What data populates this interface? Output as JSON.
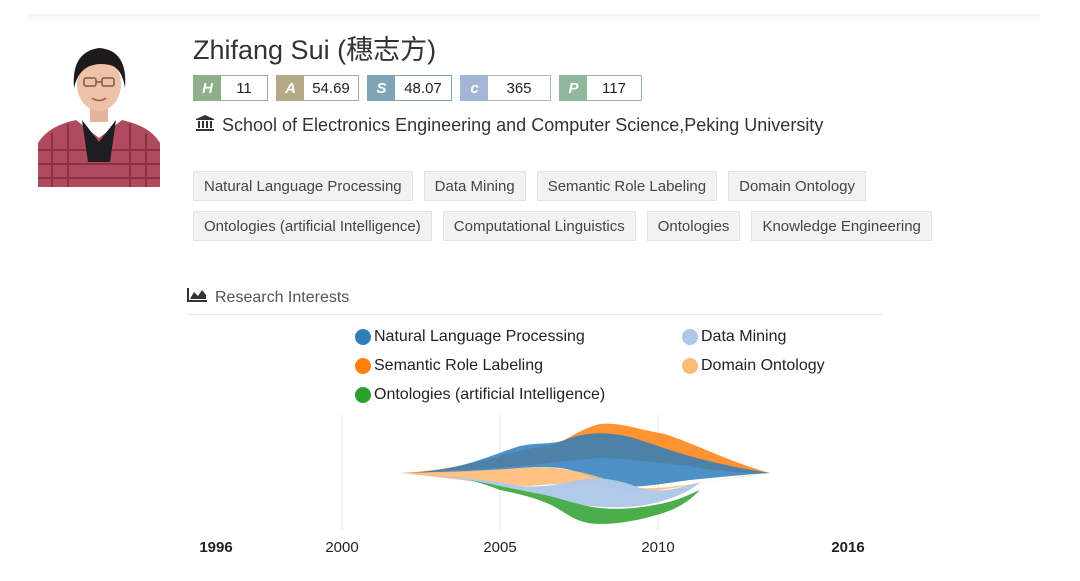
{
  "profile": {
    "name": "Zhifang Sui (穗志方)",
    "affiliation": "School of Electronics Engineering and Computer Science,Peking University",
    "affiliation_icon": "institution-icon"
  },
  "indices": [
    {
      "label": "H",
      "value": "11",
      "color": "#8fae8a"
    },
    {
      "label": "A",
      "value": "54.69",
      "color": "#b6a98a"
    },
    {
      "label": "S",
      "value": "48.07",
      "color": "#7fa4b6"
    },
    {
      "label": "c",
      "value": "365",
      "color": "#a3b6d6"
    },
    {
      "label": "P",
      "value": "117",
      "color": "#8fb89e"
    }
  ],
  "tags": [
    "Natural Language Processing",
    "Data Mining",
    "Semantic Role Labeling",
    "Domain Ontology",
    "Ontologies (artificial Intelligence)",
    "Computational Linguistics",
    "Ontologies",
    "Knowledge Engineering"
  ],
  "research": {
    "heading": "Research Interests",
    "icon": "area-chart-icon"
  },
  "chart_data": {
    "type": "area",
    "title": "",
    "legend_placement": "top",
    "series": [
      {
        "name": "Natural Language Processing",
        "color": "#2f7ebc"
      },
      {
        "name": "Data Mining",
        "color": "#aec7e8"
      },
      {
        "name": "Semantic Role Labeling",
        "color": "#ff7f0e"
      },
      {
        "name": "Domain Ontology",
        "color": "#ffbb78"
      },
      {
        "name": "Ontologies (artificial Intelligence)",
        "color": "#2ca02c"
      }
    ],
    "x_ticks": [
      "1996",
      "2000",
      "2005",
      "2010",
      "2016"
    ],
    "x_range": [
      1996,
      2016
    ]
  }
}
